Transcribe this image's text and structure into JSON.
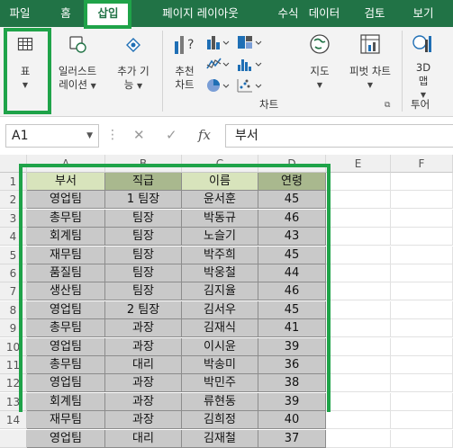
{
  "ribbon_tabs": [
    "파일",
    "홈",
    "삽입",
    "페이지 레이아웃",
    "수식",
    "데이터",
    "검토",
    "보기"
  ],
  "active_tab": "삽입",
  "ribbon": {
    "table_btn": "표",
    "illustration_line1": "일러스트",
    "illustration_line2": "레이션",
    "addin_line1": "추가 기",
    "addin_line2": "능",
    "recommended_chart_line1": "추천",
    "recommended_chart_line2": "차트",
    "map_btn": "지도",
    "pivot_chart_btn": "피벗 차트",
    "map3d_line1": "3D",
    "map3d_line2": "맵",
    "group_chart": "차트",
    "group_tour": "투어"
  },
  "formula_bar": {
    "name_box": "A1",
    "fx_label": "fx",
    "formula_value": "부서"
  },
  "columns": [
    "A",
    "B",
    "C",
    "D",
    "E",
    "F"
  ],
  "row_numbers": [
    "1",
    "2",
    "3",
    "4",
    "5",
    "6",
    "7",
    "8",
    "9",
    "10",
    "11",
    "12",
    "13",
    "14"
  ],
  "table": {
    "headers": [
      "부서",
      "직급",
      "이름",
      "연령"
    ],
    "rows": [
      [
        "영업팀",
        "1 팀장",
        "윤서훈",
        "45"
      ],
      [
        "총무팀",
        "팀장",
        "박동규",
        "46"
      ],
      [
        "회계팀",
        "팀장",
        "노슬기",
        "43"
      ],
      [
        "재무팀",
        "팀장",
        "박주희",
        "45"
      ],
      [
        "품질팀",
        "팀장",
        "박웅철",
        "44"
      ],
      [
        "생산팀",
        "팀장",
        "김지율",
        "46"
      ],
      [
        "영업팀",
        "2 팀장",
        "김서우",
        "45"
      ],
      [
        "총무팀",
        "과장",
        "김재식",
        "41"
      ],
      [
        "영업팀",
        "과장",
        "이시윤",
        "39"
      ],
      [
        "총무팀",
        "대리",
        "박송미",
        "36"
      ],
      [
        "영업팀",
        "과장",
        "박민주",
        "38"
      ],
      [
        "회계팀",
        "과장",
        "류현동",
        "39"
      ],
      [
        "재무팀",
        "과장",
        "김희정",
        "40"
      ],
      [
        "영업팀",
        "대리",
        "김재철",
        "37"
      ]
    ]
  },
  "colors": {
    "excel_green": "#217346",
    "highlight_green": "#1fa349",
    "header_fill": "#d8e4bc",
    "data_fill": "#c9c9c9"
  }
}
